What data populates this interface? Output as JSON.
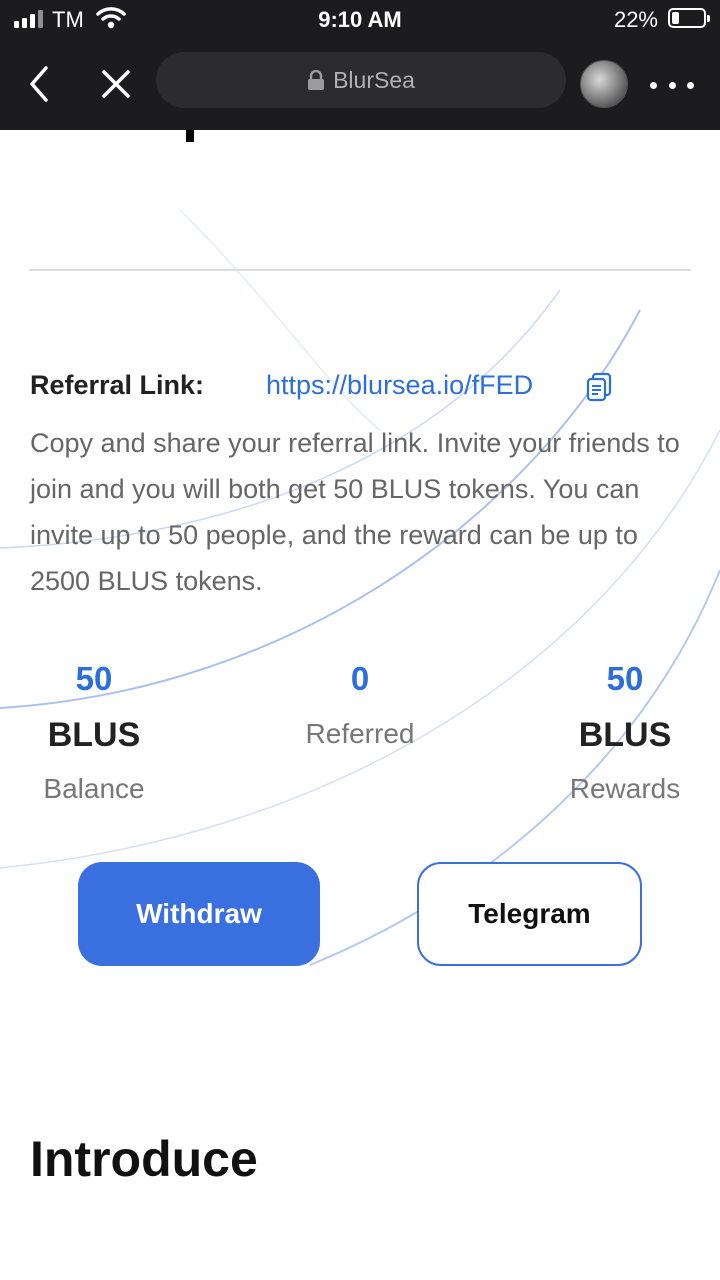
{
  "status_bar": {
    "carrier": "TM",
    "time": "9:10 AM",
    "battery_percent": "22%",
    "battery_level": 0.22,
    "icons": [
      "signal-icon",
      "wifi-icon",
      "battery-icon"
    ]
  },
  "browser": {
    "site_title": "BlurSea",
    "icons": [
      "back-icon",
      "close-icon",
      "lock-icon",
      "avatar",
      "more-icon"
    ]
  },
  "referral": {
    "label": "Referral Link:",
    "link": "https://blursea.io/fFED",
    "description": "Copy and share your referral link. Invite your friends to join and you will both get 50 BLUS tokens. You can invite up to 50 people, and the reward can be up to 2500 BLUS tokens."
  },
  "stats": {
    "balance": {
      "value": "50",
      "unit": "BLUS",
      "caption": "Balance"
    },
    "referred": {
      "value": "0",
      "caption": "Referred"
    },
    "rewards": {
      "value": "50",
      "unit": "BLUS",
      "caption": "Rewards"
    }
  },
  "actions": {
    "withdraw_label": "Withdraw",
    "telegram_label": "Telegram"
  },
  "sections": {
    "introduce_title": "Introduce"
  },
  "colors": {
    "accent": "#3a6fe0",
    "link": "#2a6fdb",
    "topbar": "#1c1c1e"
  }
}
